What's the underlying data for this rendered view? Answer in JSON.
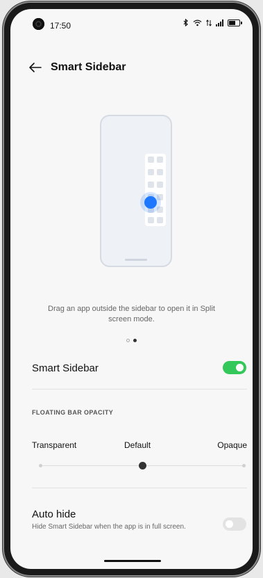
{
  "status_bar": {
    "time": "17:50",
    "icons": [
      "bluetooth-icon",
      "wifi-icon",
      "signal-icon",
      "battery-icon"
    ]
  },
  "header": {
    "back_icon": "arrow-left-icon",
    "title": "Smart Sidebar"
  },
  "illustration": {
    "description_icon": "sidebar-demo-illustration"
  },
  "caption": "Drag an app outside the sidebar to open it in Split screen mode.",
  "pager": {
    "pages": 2,
    "active": 2
  },
  "smart_sidebar": {
    "label": "Smart Sidebar",
    "enabled": true
  },
  "opacity": {
    "section_title": "FLOATING BAR OPACITY",
    "labels": [
      "Transparent",
      "Default",
      "Opaque"
    ],
    "selected_index": 1,
    "steps": 3
  },
  "auto_hide": {
    "label": "Auto hide",
    "description": "Hide Smart Sidebar when the app is in full screen.",
    "enabled": false
  },
  "colors": {
    "accent_green": "#34c759",
    "accent_blue": "#1e78ff",
    "toggle_off": "#e3e3e3"
  }
}
